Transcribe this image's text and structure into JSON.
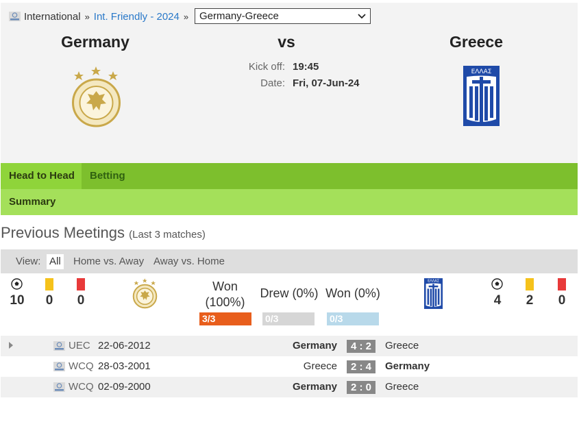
{
  "breadcrumb": {
    "root": "International",
    "competition": "Int. Friendly - 2024",
    "match_select": "Germany-Greece"
  },
  "match": {
    "home": "Germany",
    "vs": "vs",
    "away": "Greece",
    "kickoff_label": "Kick off:",
    "kickoff_value": "19:45",
    "date_label": "Date:",
    "date_value": "Fri, 07-Jun-24",
    "away_flag_text": "ΕΛΛΑΣ"
  },
  "tabs": {
    "head_to_head": "Head to Head",
    "betting": "Betting",
    "summary": "Summary"
  },
  "previous_meetings": {
    "title": "Previous Meetings",
    "subtitle": "(Last 3 matches)",
    "view_label": "View:",
    "view_options": [
      "All",
      "Home vs. Away",
      "Away vs. Home"
    ],
    "home_stats": {
      "goals": "10",
      "yellow": "0",
      "red": "0"
    },
    "away_stats": {
      "goals": "4",
      "yellow": "2",
      "red": "0"
    },
    "won_label": "Won",
    "won_pct": "(100%)",
    "won_count": "3/3",
    "drew_label": "Drew (0%)",
    "drew_count": "0/3",
    "lost_label": "Won (0%)",
    "lost_count": "0/3",
    "matches": [
      {
        "comp": "UEC",
        "date": "22-06-2012",
        "home": "Germany",
        "score": "4 : 2",
        "away": "Greece",
        "winner": "home"
      },
      {
        "comp": "WCQ",
        "date": "28-03-2001",
        "home": "Greece",
        "score": "2 : 4",
        "away": "Germany",
        "winner": "away"
      },
      {
        "comp": "WCQ",
        "date": "02-09-2000",
        "home": "Germany",
        "score": "2 : 0",
        "away": "Greece",
        "winner": "home"
      }
    ]
  },
  "colors": {
    "tab_green": "#7dbf2d",
    "tab_active": "#8fd43a",
    "subbar_green": "#a4e05a",
    "won_bar": "#e85e1c",
    "drew_bar": "#d6d6d6",
    "lost_bar": "#b8d9ea",
    "link": "#2a79c9",
    "gold": "#c9a84a",
    "greece_blue": "#1f4aa8"
  },
  "icons": [
    "fifa-logo-icon",
    "chevron-down-icon",
    "football-icon",
    "yellow-card-icon",
    "red-card-icon",
    "germany-crest-icon",
    "greece-flag-icon",
    "expand-arrow-icon"
  ]
}
